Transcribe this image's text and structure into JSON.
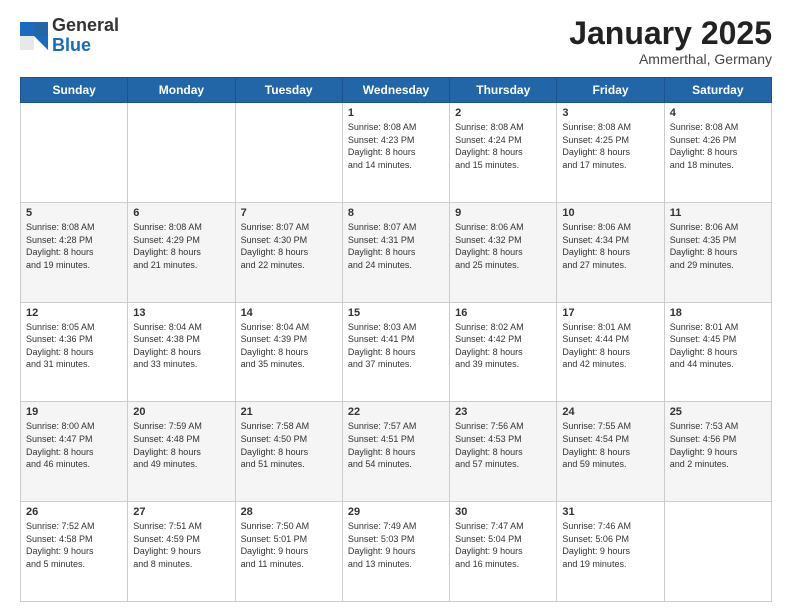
{
  "header": {
    "logo_general": "General",
    "logo_blue": "Blue",
    "month_title": "January 2025",
    "location": "Ammerthal, Germany"
  },
  "days_of_week": [
    "Sunday",
    "Monday",
    "Tuesday",
    "Wednesday",
    "Thursday",
    "Friday",
    "Saturday"
  ],
  "weeks": [
    [
      {
        "day": "",
        "info": ""
      },
      {
        "day": "",
        "info": ""
      },
      {
        "day": "",
        "info": ""
      },
      {
        "day": "1",
        "info": "Sunrise: 8:08 AM\nSunset: 4:23 PM\nDaylight: 8 hours\nand 14 minutes."
      },
      {
        "day": "2",
        "info": "Sunrise: 8:08 AM\nSunset: 4:24 PM\nDaylight: 8 hours\nand 15 minutes."
      },
      {
        "day": "3",
        "info": "Sunrise: 8:08 AM\nSunset: 4:25 PM\nDaylight: 8 hours\nand 17 minutes."
      },
      {
        "day": "4",
        "info": "Sunrise: 8:08 AM\nSunset: 4:26 PM\nDaylight: 8 hours\nand 18 minutes."
      }
    ],
    [
      {
        "day": "5",
        "info": "Sunrise: 8:08 AM\nSunset: 4:28 PM\nDaylight: 8 hours\nand 19 minutes."
      },
      {
        "day": "6",
        "info": "Sunrise: 8:08 AM\nSunset: 4:29 PM\nDaylight: 8 hours\nand 21 minutes."
      },
      {
        "day": "7",
        "info": "Sunrise: 8:07 AM\nSunset: 4:30 PM\nDaylight: 8 hours\nand 22 minutes."
      },
      {
        "day": "8",
        "info": "Sunrise: 8:07 AM\nSunset: 4:31 PM\nDaylight: 8 hours\nand 24 minutes."
      },
      {
        "day": "9",
        "info": "Sunrise: 8:06 AM\nSunset: 4:32 PM\nDaylight: 8 hours\nand 25 minutes."
      },
      {
        "day": "10",
        "info": "Sunrise: 8:06 AM\nSunset: 4:34 PM\nDaylight: 8 hours\nand 27 minutes."
      },
      {
        "day": "11",
        "info": "Sunrise: 8:06 AM\nSunset: 4:35 PM\nDaylight: 8 hours\nand 29 minutes."
      }
    ],
    [
      {
        "day": "12",
        "info": "Sunrise: 8:05 AM\nSunset: 4:36 PM\nDaylight: 8 hours\nand 31 minutes."
      },
      {
        "day": "13",
        "info": "Sunrise: 8:04 AM\nSunset: 4:38 PM\nDaylight: 8 hours\nand 33 minutes."
      },
      {
        "day": "14",
        "info": "Sunrise: 8:04 AM\nSunset: 4:39 PM\nDaylight: 8 hours\nand 35 minutes."
      },
      {
        "day": "15",
        "info": "Sunrise: 8:03 AM\nSunset: 4:41 PM\nDaylight: 8 hours\nand 37 minutes."
      },
      {
        "day": "16",
        "info": "Sunrise: 8:02 AM\nSunset: 4:42 PM\nDaylight: 8 hours\nand 39 minutes."
      },
      {
        "day": "17",
        "info": "Sunrise: 8:01 AM\nSunset: 4:44 PM\nDaylight: 8 hours\nand 42 minutes."
      },
      {
        "day": "18",
        "info": "Sunrise: 8:01 AM\nSunset: 4:45 PM\nDaylight: 8 hours\nand 44 minutes."
      }
    ],
    [
      {
        "day": "19",
        "info": "Sunrise: 8:00 AM\nSunset: 4:47 PM\nDaylight: 8 hours\nand 46 minutes."
      },
      {
        "day": "20",
        "info": "Sunrise: 7:59 AM\nSunset: 4:48 PM\nDaylight: 8 hours\nand 49 minutes."
      },
      {
        "day": "21",
        "info": "Sunrise: 7:58 AM\nSunset: 4:50 PM\nDaylight: 8 hours\nand 51 minutes."
      },
      {
        "day": "22",
        "info": "Sunrise: 7:57 AM\nSunset: 4:51 PM\nDaylight: 8 hours\nand 54 minutes."
      },
      {
        "day": "23",
        "info": "Sunrise: 7:56 AM\nSunset: 4:53 PM\nDaylight: 8 hours\nand 57 minutes."
      },
      {
        "day": "24",
        "info": "Sunrise: 7:55 AM\nSunset: 4:54 PM\nDaylight: 8 hours\nand 59 minutes."
      },
      {
        "day": "25",
        "info": "Sunrise: 7:53 AM\nSunset: 4:56 PM\nDaylight: 9 hours\nand 2 minutes."
      }
    ],
    [
      {
        "day": "26",
        "info": "Sunrise: 7:52 AM\nSunset: 4:58 PM\nDaylight: 9 hours\nand 5 minutes."
      },
      {
        "day": "27",
        "info": "Sunrise: 7:51 AM\nSunset: 4:59 PM\nDaylight: 9 hours\nand 8 minutes."
      },
      {
        "day": "28",
        "info": "Sunrise: 7:50 AM\nSunset: 5:01 PM\nDaylight: 9 hours\nand 11 minutes."
      },
      {
        "day": "29",
        "info": "Sunrise: 7:49 AM\nSunset: 5:03 PM\nDaylight: 9 hours\nand 13 minutes."
      },
      {
        "day": "30",
        "info": "Sunrise: 7:47 AM\nSunset: 5:04 PM\nDaylight: 9 hours\nand 16 minutes."
      },
      {
        "day": "31",
        "info": "Sunrise: 7:46 AM\nSunset: 5:06 PM\nDaylight: 9 hours\nand 19 minutes."
      },
      {
        "day": "",
        "info": ""
      }
    ]
  ]
}
